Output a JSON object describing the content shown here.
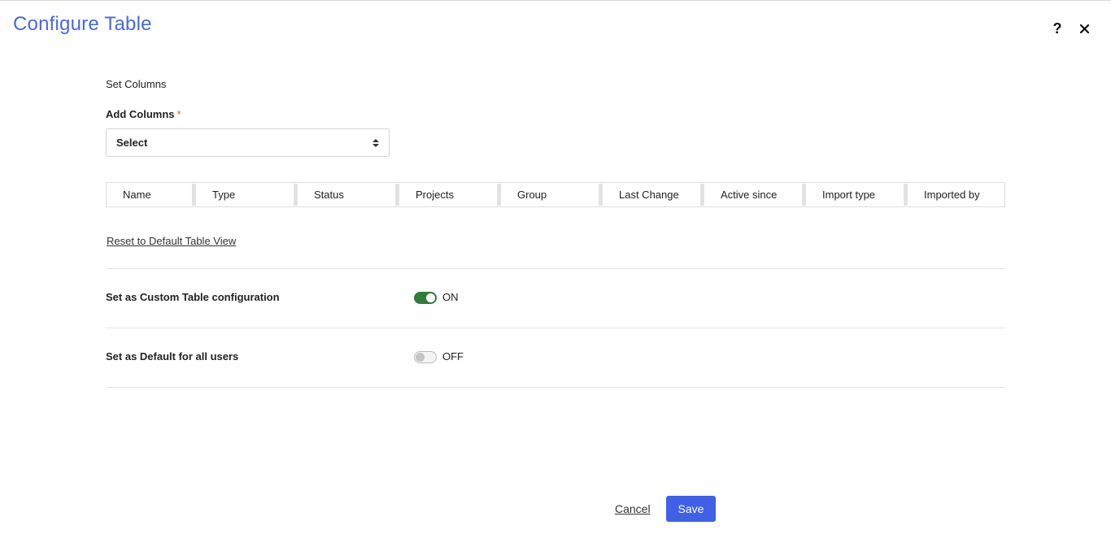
{
  "dialog": {
    "title": "Configure Table",
    "help_label": "?",
    "close_label": "✕"
  },
  "columns_section": {
    "heading": "Set Columns",
    "add_columns_label": "Add Columns",
    "required_marker": "*",
    "select": {
      "value": "Select"
    },
    "columns": [
      "Name",
      "Type",
      "Status",
      "Projects",
      "Group",
      "Last Change",
      "Active since",
      "Import type",
      "Imported by"
    ],
    "reset_link": "Reset to Default Table View"
  },
  "settings": {
    "custom_config": {
      "label": "Set as Custom Table configuration",
      "state": "ON",
      "enabled": true
    },
    "default_all_users": {
      "label": "Set as Default for all users",
      "state": "OFF",
      "enabled": false
    }
  },
  "footer": {
    "cancel_label": "Cancel",
    "save_label": "Save"
  },
  "colors": {
    "title": "#4a67e0",
    "toggle_on": "#2e7d3a",
    "save_button": "#4060e8",
    "required": "#e2554c"
  }
}
